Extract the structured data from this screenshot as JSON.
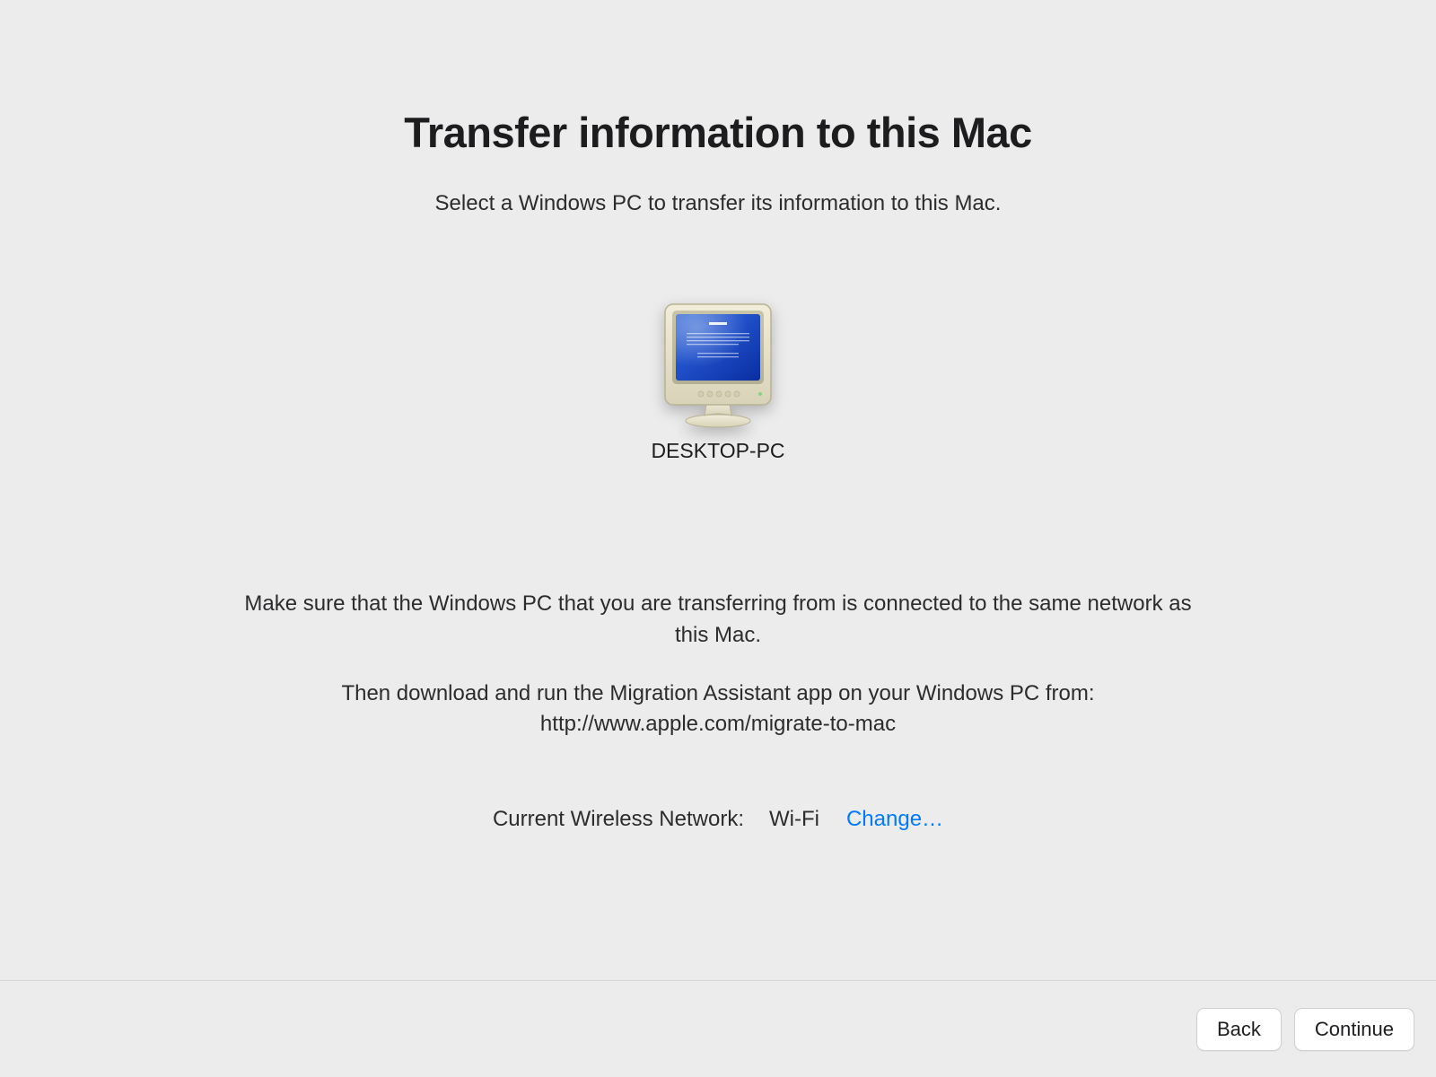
{
  "title": "Transfer information to this Mac",
  "subtitle": "Select a Windows PC to transfer its information to this Mac.",
  "device": {
    "name": "DESKTOP-PC"
  },
  "instruction_line1": "Make sure that the Windows PC that you are transferring from is connected to the same network as this Mac.",
  "instruction_line2": "Then download and run the Migration Assistant app on your Windows PC from: http://www.apple.com/migrate-to-mac",
  "network": {
    "label": "Current Wireless Network:",
    "name": "Wi-Fi",
    "change_label": "Change…"
  },
  "buttons": {
    "back": "Back",
    "continue": "Continue"
  }
}
